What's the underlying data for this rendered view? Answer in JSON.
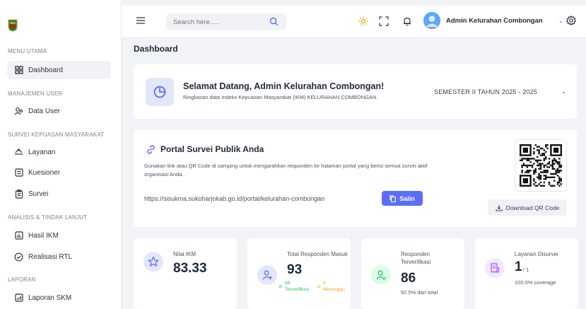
{
  "sidebar": {
    "sections": [
      {
        "title": "MENU UTAMA",
        "items": [
          {
            "label": "Dashboard",
            "icon": "grid-icon",
            "active": true
          }
        ]
      },
      {
        "title": "MANAJEMEN USER",
        "items": [
          {
            "label": "Data User",
            "icon": "users-icon"
          }
        ]
      },
      {
        "title": "SURVEI KEPUASAN MASYARAKAT",
        "items": [
          {
            "label": "Layanan",
            "icon": "service-icon"
          },
          {
            "label": "Kuesioner",
            "icon": "questionnaire-icon"
          },
          {
            "label": "Survei",
            "icon": "clipboard-icon"
          }
        ]
      },
      {
        "title": "ANALISIS & TINDAK LANJUT",
        "items": [
          {
            "label": "Hasil IKM",
            "icon": "chart-icon"
          },
          {
            "label": "Realisasi RTL",
            "icon": "check-circle-icon"
          }
        ]
      },
      {
        "title": "LAPORAN",
        "items": [
          {
            "label": "Laporan SKM",
            "icon": "report-icon"
          }
        ]
      }
    ]
  },
  "topbar": {
    "search_placeholder": "Search here.....",
    "user_name": "Admin Kelurahan Combongan",
    "caret": "⌄"
  },
  "page": {
    "title": "Dashboard"
  },
  "welcome": {
    "title": "Selamat Datang, Admin Kelurahan Combongan!",
    "subtitle": "Ringkasan data Indeks Kepuasan Masyarakat (IKM) KELURAHAN COMBONGAN.",
    "semester": "SEMESTER II TAHUN 2025 - 2025"
  },
  "portal": {
    "title": "Portal Survei Publik Anda",
    "description": "Gunakan link atau QR Code di samping untuk mengarahkan responden ke halaman portal yang berisi semua survei aktif organisasi Anda.",
    "url": "https://sisukma.sukoharjokab.go.id/portal/kelurahan-combongan",
    "copy_label": "Salin",
    "download_label": "Download QR Code"
  },
  "stats": {
    "ikm": {
      "label": "Nilai IKM",
      "value": "83.33"
    },
    "responden": {
      "label": "Total Responden Masuk",
      "value": "93",
      "verified": "86",
      "verified_label": "Terverifikasi",
      "pending": "0",
      "pending_label": "Menunggu"
    },
    "verified": {
      "label": "Responden Terverifikasi",
      "value": "86",
      "note": "92.5% dari total"
    },
    "layanan": {
      "label": "Layanan Disurvei",
      "value": "1",
      "total": "/ 1",
      "note": "100.0% coverage"
    }
  },
  "colors": {
    "accent": "#5b6ef5",
    "sun": "#f59e0b",
    "green": "#22c55e",
    "amber": "#f59e0b"
  }
}
